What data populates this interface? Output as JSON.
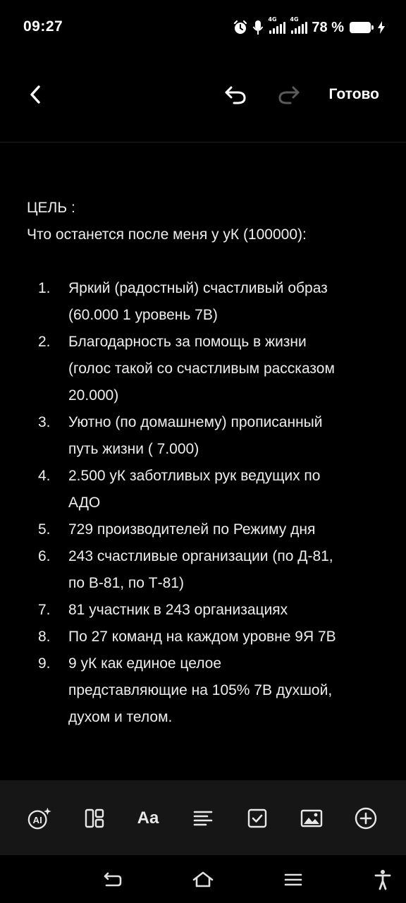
{
  "status_bar": {
    "time": "09:27",
    "network_1": "4G",
    "network_2": "4G",
    "battery_percent": "78 %",
    "icons": [
      "alarm-icon",
      "microphone-icon",
      "signal-icon",
      "signal-icon",
      "battery-icon",
      "charging-icon"
    ]
  },
  "toolbar": {
    "done_label": "Готово",
    "icons": [
      "back-icon",
      "undo-icon",
      "redo-icon"
    ]
  },
  "note": {
    "heading": "ЦЕЛЬ :",
    "subtitle": "Что останется после меня у уК (100000):",
    "items": [
      {
        "num": "1.",
        "lines": [
          "Яркий (радостный) счастливый образ",
          "(60.000 1 уровень 7В)"
        ]
      },
      {
        "num": "2.",
        "lines": [
          "Благодарность за помощь в жизни",
          "(голос такой со счастливым рассказом",
          "20.000)"
        ]
      },
      {
        "num": "3.",
        "lines": [
          "Уютно (по домашнему) прописанный",
          "путь жизни  ( 7.000)"
        ]
      },
      {
        "num": "4.",
        "lines": [
          "2.500 уК заботливых рук ведущих по",
          "АДО"
        ]
      },
      {
        "num": "5.",
        "lines": [
          "729 производителей по Режиму дня"
        ]
      },
      {
        "num": "6.",
        "lines": [
          "243  счастливые организации (по Д-81,",
          "по В-81, по Т-81)"
        ]
      },
      {
        "num": "7.",
        "lines": [
          "81 участник в 243 организациях"
        ]
      },
      {
        "num": "8.",
        "lines": [
          "По 27 команд на каждом уровне 9Я 7В"
        ]
      },
      {
        "num": "9.",
        "lines": [
          "9 уК как единое целое",
          "представляющие на 105% 7В духшой,",
          "духом и телом."
        ]
      }
    ]
  },
  "format_bar": {
    "text_style_label": "Aa",
    "ai_label": "AI",
    "icons": [
      "ai-icon",
      "layout-icon",
      "text-style-icon",
      "align-icon",
      "checkbox-icon",
      "image-icon",
      "add-icon"
    ]
  },
  "nav_bar": {
    "icons": [
      "nav-back-icon",
      "home-icon",
      "menu-icon",
      "accessibility-icon"
    ]
  },
  "colors": {
    "background": "#000000",
    "text": "#eeeeee",
    "format_bar": "#161616",
    "redo_disabled": "#5a5a5a"
  }
}
